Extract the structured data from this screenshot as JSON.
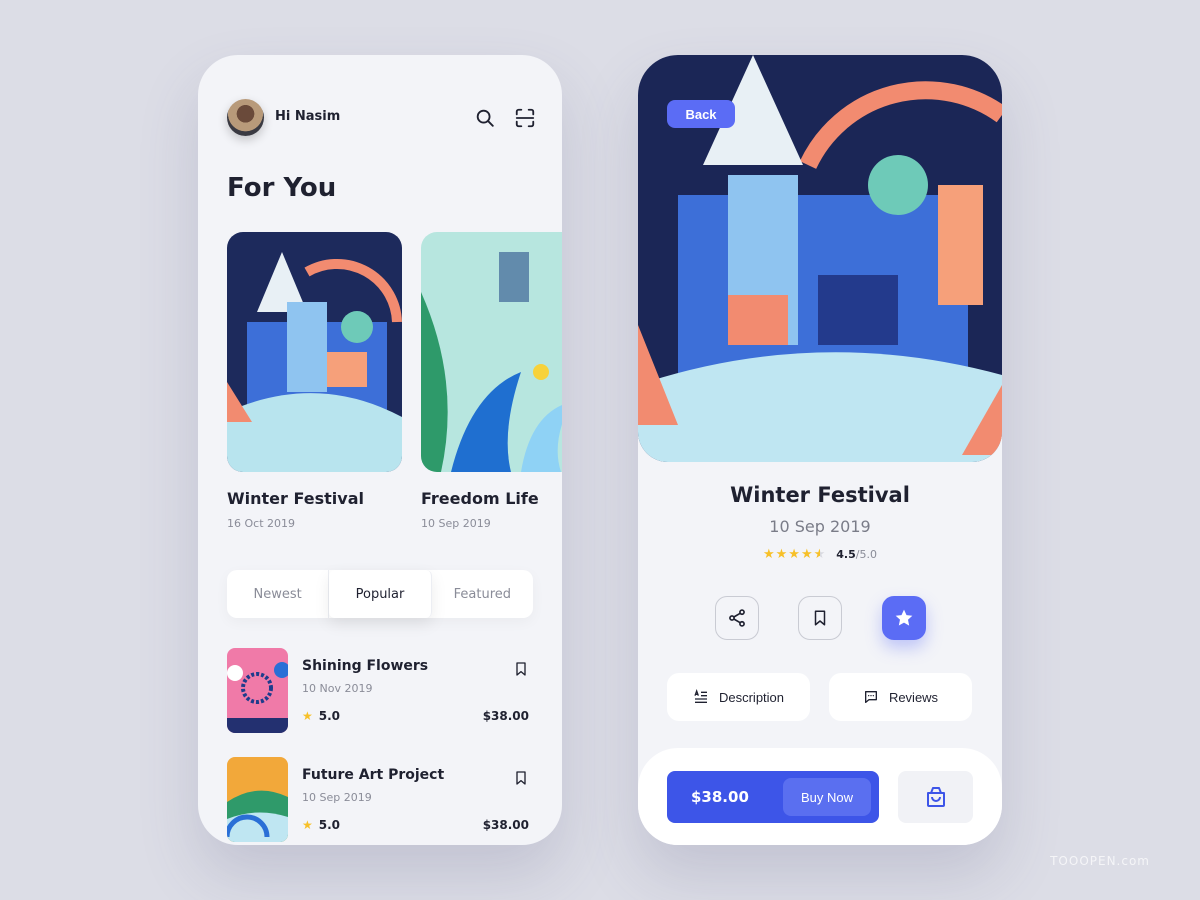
{
  "home": {
    "greeting": "Hi Nasim",
    "heading": "For You",
    "featured": [
      {
        "title": "Winter Festival",
        "date": "16 Oct 2019"
      },
      {
        "title": "Freedom Life",
        "date": "10 Sep 2019"
      }
    ],
    "tabs": [
      {
        "label": "Newest"
      },
      {
        "label": "Popular",
        "active": true
      },
      {
        "label": "Featured"
      }
    ],
    "list": [
      {
        "title": "Shining Flowers",
        "date": "10 Nov 2019",
        "rating": "5.0",
        "price": "$38.00"
      },
      {
        "title": "Future Art Project",
        "date": "10 Sep 2019",
        "rating": "5.0",
        "price": "$38.00"
      }
    ]
  },
  "detail": {
    "back_label": "Back",
    "title": "Winter Festival",
    "date": "10 Sep 2019",
    "rating": "4.5",
    "rating_max": "/5.0",
    "stars": 4.5,
    "description_label": "Description",
    "reviews_label": "Reviews",
    "price": "$38.00",
    "buy_label": "Buy Now"
  },
  "colors": {
    "accent": "#5b6cf5",
    "buy": "#3d55e8",
    "star": "#f7c028",
    "background": "#dcdde6"
  },
  "watermark": "TOOOPEN.com"
}
